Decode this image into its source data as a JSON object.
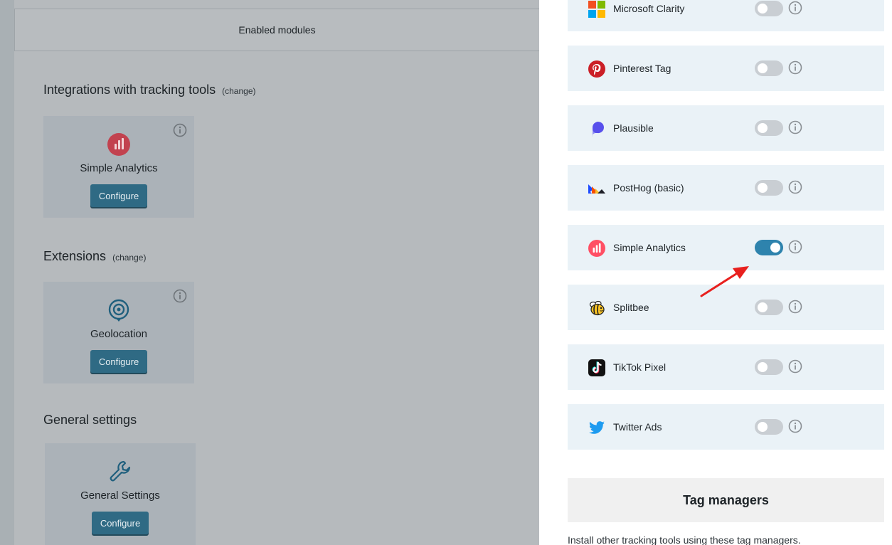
{
  "left": {
    "header_title": "Enabled modules",
    "sections": [
      {
        "title": "Integrations with tracking tools",
        "change_label": "(change)",
        "card": {
          "name": "Simple Analytics",
          "button": "Configure",
          "icon": "bar-chart-circle-icon"
        }
      },
      {
        "title": "Extensions",
        "change_label": "(change)",
        "card": {
          "name": "Geolocation",
          "button": "Configure",
          "icon": "location-pin-icon"
        }
      },
      {
        "title": "General settings",
        "change_label": "",
        "card": {
          "name": "General Settings",
          "button": "Configure",
          "icon": "wrench-icon"
        }
      }
    ]
  },
  "right": {
    "tools": [
      {
        "name": "Microsoft Clarity",
        "enabled": false,
        "icon": "microsoft-logo-icon"
      },
      {
        "name": "Pinterest Tag",
        "enabled": false,
        "icon": "pinterest-logo-icon"
      },
      {
        "name": "Plausible",
        "enabled": false,
        "icon": "plausible-logo-icon"
      },
      {
        "name": "PostHog (basic)",
        "enabled": false,
        "icon": "posthog-logo-icon"
      },
      {
        "name": "Simple Analytics",
        "enabled": true,
        "icon": "simple-analytics-logo-icon"
      },
      {
        "name": "Splitbee",
        "enabled": false,
        "icon": "splitbee-logo-icon"
      },
      {
        "name": "TikTok Pixel",
        "enabled": false,
        "icon": "tiktok-logo-icon"
      },
      {
        "name": "Twitter Ads",
        "enabled": false,
        "icon": "twitter-logo-icon"
      }
    ],
    "tag_managers_title": "Tag managers",
    "tag_managers_desc": "Install other tracking tools using these tag managers."
  },
  "colors": {
    "toggle_on": "#2e83ad",
    "toggle_off": "#c9ced3",
    "configure_button": "#2f6a84",
    "annotation_arrow": "#e8201e"
  }
}
